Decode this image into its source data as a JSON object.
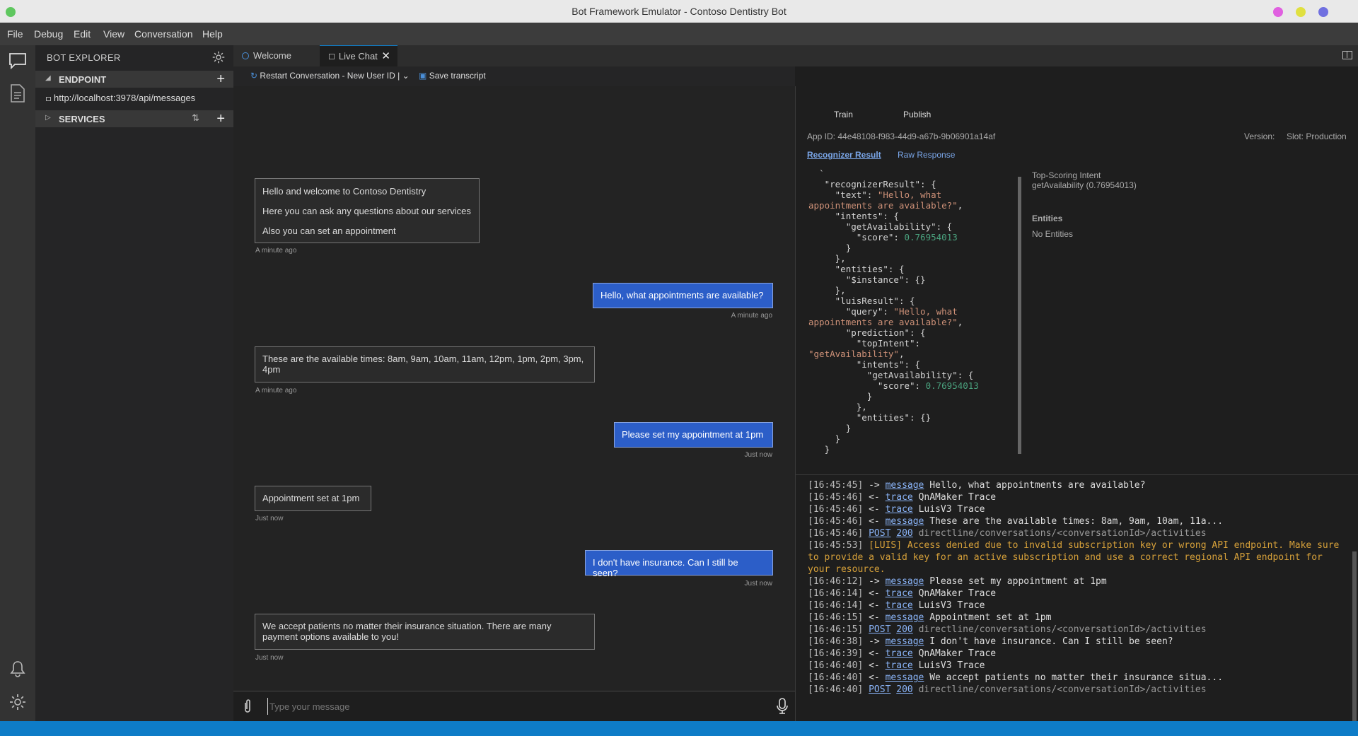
{
  "window": {
    "title": "Bot Framework Emulator - Contoso Dentistry Bot",
    "colors": {
      "status_bar": "#0e7cc7",
      "user_bubble": "#2c5ec8",
      "traffic": [
        "#e060e0",
        "#e0e040",
        "#7070e0"
      ]
    }
  },
  "menu": [
    "File",
    "Debug",
    "Edit",
    "View",
    "Conversation",
    "Help"
  ],
  "explorer": {
    "title": "BOT EXPLORER",
    "endpoint_label": "ENDPOINT",
    "endpoint_url": "http://localhost:3978/api/messages",
    "services_label": "SERVICES"
  },
  "tabs": {
    "welcome": "Welcome",
    "live_chat": "Live Chat"
  },
  "toolbar": {
    "restart": "Restart Conversation - New User ID |",
    "save": "Save transcript"
  },
  "chat": {
    "messages": [
      {
        "from": "bot",
        "lines": [
          "Hello and welcome to Contoso Dentistry",
          "Here you can ask any questions about our services",
          "Also you can set an appointment"
        ],
        "time": "A minute ago"
      },
      {
        "from": "user",
        "text": "Hello, what appointments are available?",
        "time": "A minute ago"
      },
      {
        "from": "bot",
        "text": "These are the available times: 8am, 9am, 10am, 11am, 12pm, 1pm, 2pm, 3pm, 4pm",
        "time": "A minute ago"
      },
      {
        "from": "user",
        "text": "Please set my appointment at 1pm",
        "time": "Just now"
      },
      {
        "from": "bot",
        "text": "Appointment set at 1pm",
        "time": "Just now"
      },
      {
        "from": "user",
        "text": "I don't have insurance. Can I still be seen?",
        "time": "Just now"
      },
      {
        "from": "bot",
        "text": "We accept patients no matter their insurance situation. There are many payment options available to you!",
        "time": "Just now"
      }
    ],
    "input_placeholder": "Type your message"
  },
  "inspector": {
    "train": "Train",
    "publish": "Publish",
    "app_id": "App ID: 44e48108-f983-44d9-a67b-9b06901a14af",
    "version": "Version:",
    "slot": "Slot: Production",
    "tab_recognizer": "Recognizer Result",
    "tab_raw": "Raw Response",
    "top_intent_label": "Top-Scoring Intent",
    "top_intent_value": "getAvailability (0.76954013)",
    "entities_label": "Entities",
    "entities_value": "No Entities",
    "json": {
      "backtick": "`",
      "k_recognizer": "\"recognizerResult\": {",
      "k_text": "\"text\": ",
      "v_text1": "\"Hello, what",
      "v_text2": "appointments are available?\"",
      "comma": ",",
      "k_intents": "\"intents\": {",
      "k_getAvail": "\"getAvailability\": {",
      "k_score": "\"score\": ",
      "v_score": "0.76954013",
      "close": "}",
      "close_comma": "},",
      "k_entities": "\"entities\": {",
      "k_instance": "\"$instance\": {}",
      "k_luis": "\"luisResult\": {",
      "k_query": "\"query\": ",
      "k_prediction": "\"prediction\": {",
      "k_topIntent": "\"topIntent\":",
      "v_topIntent": "\"getAvailability\"",
      "k_entities_empty": "\"entities\": {}"
    }
  },
  "log": [
    {
      "time": "[16:45:45]",
      "dir": "->",
      "kind": "message",
      "text": "Hello, what appointments are available?"
    },
    {
      "time": "[16:45:46]",
      "dir": "<-",
      "kind": "trace",
      "text": "QnAMaker Trace"
    },
    {
      "time": "[16:45:46]",
      "dir": "<-",
      "kind": "trace",
      "text": "LuisV3 Trace"
    },
    {
      "time": "[16:45:46]",
      "dir": "<-",
      "kind": "message",
      "text": "These are the available times: 8am, 9am, 10am, 11a..."
    },
    {
      "time": "[16:45:46]",
      "dir": "",
      "kind": "POST",
      "code": "200",
      "text": "directline/conversations/<conversationId>/activities"
    },
    {
      "time": "[16:45:53]",
      "warn": "[LUIS] Access denied due to invalid subscription key or wrong API endpoint. Make sure",
      "warn2": "to provide a valid key for an active subscription and use a correct regional API endpoint for",
      "warn3": "your resource."
    },
    {
      "time": "[16:46:12]",
      "dir": "->",
      "kind": "message",
      "text": "Please set my appointment at 1pm"
    },
    {
      "time": "[16:46:14]",
      "dir": "<-",
      "kind": "trace",
      "text": "QnAMaker Trace"
    },
    {
      "time": "[16:46:14]",
      "dir": "<-",
      "kind": "trace",
      "text": "LuisV3 Trace"
    },
    {
      "time": "[16:46:15]",
      "dir": "<-",
      "kind": "message",
      "text": "Appointment set at 1pm"
    },
    {
      "time": "[16:46:15]",
      "dir": "",
      "kind": "POST",
      "code": "200",
      "text": "directline/conversations/<conversationId>/activities"
    },
    {
      "time": "[16:46:38]",
      "dir": "->",
      "kind": "message",
      "text": "I don't have insurance. Can I still be seen?"
    },
    {
      "time": "[16:46:39]",
      "dir": "<-",
      "kind": "trace",
      "text": "QnAMaker Trace"
    },
    {
      "time": "[16:46:40]",
      "dir": "<-",
      "kind": "trace",
      "text": "LuisV3 Trace"
    },
    {
      "time": "[16:46:40]",
      "dir": "<-",
      "kind": "message",
      "text": "We accept patients no matter their insurance situa..."
    },
    {
      "time": "[16:46:40]",
      "dir": "",
      "kind": "POST",
      "code": "200",
      "text": "directline/conversations/<conversationId>/activities"
    }
  ]
}
